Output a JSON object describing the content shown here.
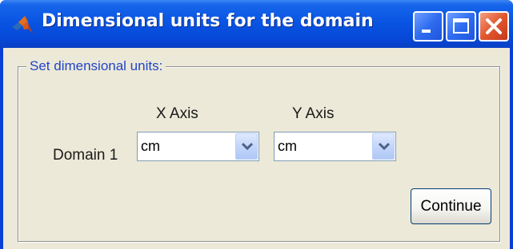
{
  "window": {
    "title": "Dimensional units for the domain",
    "icon": "matlab-logo-icon",
    "controls": [
      "minimize-icon",
      "maximize-icon",
      "close-icon"
    ]
  },
  "groupbox": {
    "legend": "Set dimensional units:"
  },
  "columns": {
    "x_axis": "X Axis",
    "y_axis": "Y Axis"
  },
  "rows": [
    {
      "label": "Domain 1",
      "x_unit": "cm",
      "y_unit": "cm"
    }
  ],
  "buttons": {
    "continue": "Continue"
  },
  "colors": {
    "titlebar": "#0a55e3",
    "dialog_background": "#ece9d8",
    "legend_text": "#2145c9",
    "close_button": "#e2572f"
  }
}
